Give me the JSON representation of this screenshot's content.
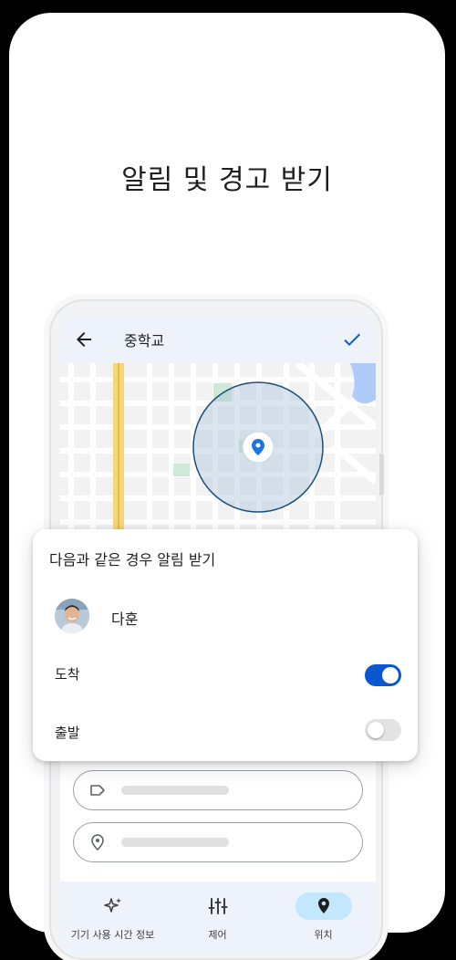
{
  "headline": "알림 및 경고 받기",
  "appbar": {
    "title": "중학교",
    "back_icon": "arrow-back-icon",
    "confirm_icon": "check-icon"
  },
  "map": {
    "pin_icon": "location-pin-icon"
  },
  "sheet": {
    "title": "다음과 같은 경우 알림 받기",
    "person": {
      "name": "다훈"
    },
    "options": [
      {
        "label": "도착",
        "enabled": true
      },
      {
        "label": "출발",
        "enabled": false
      }
    ]
  },
  "fields": [
    {
      "icon": "label-icon"
    },
    {
      "icon": "location-outline-icon"
    }
  ],
  "bottom_nav": [
    {
      "label": "기기 사용 시간 정보",
      "icon": "sparkle-icon",
      "active": false
    },
    {
      "label": "제어",
      "icon": "tune-icon",
      "active": false
    },
    {
      "label": "위치",
      "icon": "location-pin-icon",
      "active": true
    }
  ],
  "colors": {
    "accent": "#0b57d0",
    "appbar_bg": "#eef2fb",
    "geofence_stroke": "#1a4e7a",
    "road_highlight": "#f5d77a"
  }
}
